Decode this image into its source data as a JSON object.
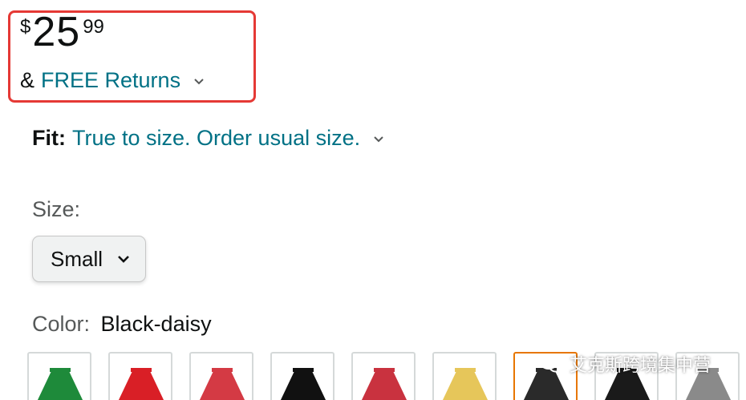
{
  "price": {
    "symbol": "$",
    "whole": "25",
    "fraction": "99"
  },
  "returns": {
    "prefix": "&",
    "link_label": "FREE Returns"
  },
  "fit": {
    "label": "Fit:",
    "value": "True to size. Order usual size."
  },
  "size": {
    "label": "Size:",
    "selected": "Small"
  },
  "color": {
    "label": "Color:",
    "selected": "Black-daisy"
  },
  "swatches": [
    {
      "name": "green",
      "color": "#1e8a3a"
    },
    {
      "name": "red",
      "color": "#d91f26"
    },
    {
      "name": "red-plaid",
      "color": "#d43a44"
    },
    {
      "name": "black",
      "color": "#111111"
    },
    {
      "name": "white-red-floral",
      "color": "#c9323f"
    },
    {
      "name": "yellow",
      "color": "#e6c65a"
    },
    {
      "name": "black-daisy",
      "color": "#2a2a2a"
    },
    {
      "name": "black-2",
      "color": "#1a1a1a"
    },
    {
      "name": "gray",
      "color": "#8a8a8a"
    }
  ],
  "watermark": {
    "text": "艾克斯跨境集中营"
  },
  "colors": {
    "link": "#007185",
    "highlight_border": "#e53935",
    "selected_swatch": "#e77600"
  }
}
